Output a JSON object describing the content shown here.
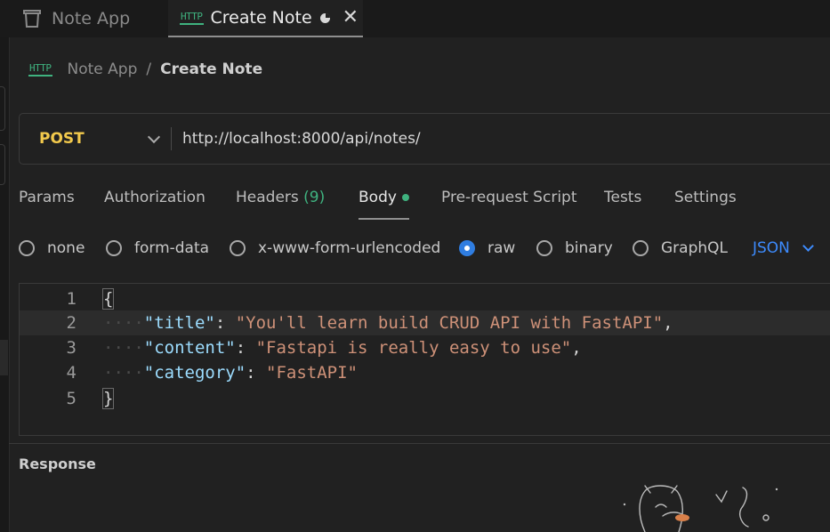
{
  "tabs": [
    {
      "label": "Note App",
      "icon": "trash-icon",
      "active": false
    },
    {
      "label": "Create Note",
      "icon": "http-icon",
      "badge": "HTTP",
      "active": true,
      "unsaved": true
    }
  ],
  "breadcrumb": {
    "badge": "HTTP",
    "parent": "Note App",
    "separator": "/",
    "current": "Create Note"
  },
  "request": {
    "method": "POST",
    "url": "http://localhost:8000/api/notes/"
  },
  "request_tabs": [
    {
      "label": "Params"
    },
    {
      "label": "Authorization"
    },
    {
      "label": "Headers",
      "count": "(9)"
    },
    {
      "label": "Body",
      "active": true,
      "indicator": true
    },
    {
      "label": "Pre-request Script"
    },
    {
      "label": "Tests"
    },
    {
      "label": "Settings"
    }
  ],
  "body_types": [
    {
      "label": "none",
      "checked": false
    },
    {
      "label": "form-data",
      "checked": false
    },
    {
      "label": "x-www-form-urlencoded",
      "checked": false
    },
    {
      "label": "raw",
      "checked": true
    },
    {
      "label": "binary",
      "checked": false
    },
    {
      "label": "GraphQL",
      "checked": false
    }
  ],
  "format_select": "JSON",
  "editor": {
    "lines": [
      {
        "n": "1",
        "open": "{"
      },
      {
        "n": "2",
        "key": "\"title\"",
        "colon": ": ",
        "value": "\"You'll learn build CRUD API with FastAPI\"",
        "comma": ","
      },
      {
        "n": "3",
        "key": "\"content\"",
        "colon": ": ",
        "value": "\"Fastapi is really easy to use\"",
        "comma": ","
      },
      {
        "n": "4",
        "key": "\"category\"",
        "colon": ": ",
        "value": "\"FastAPI\"",
        "comma": ""
      },
      {
        "n": "5",
        "close": "}"
      }
    ],
    "indent": "····"
  },
  "response": {
    "label": "Response"
  },
  "colors": {
    "accent_blue": "#2f7de1",
    "method_yellow": "#f2c94c",
    "http_green": "#3fb27f",
    "background": "#212121"
  }
}
